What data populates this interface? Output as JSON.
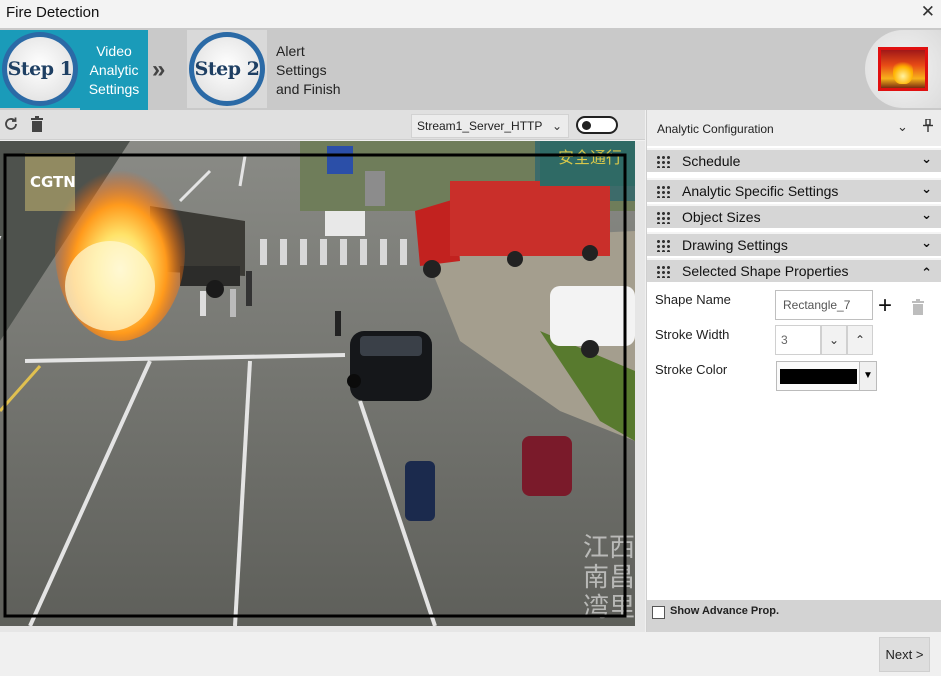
{
  "window": {
    "title": "Fire Detection",
    "close_glyph": "✕"
  },
  "steps": [
    {
      "badge": "Step 1",
      "label": "Video\nAnalytic\nSettings",
      "active": true
    },
    {
      "badge": "Step 2",
      "label": "Alert\nSettings\nand Finish",
      "active": false
    }
  ],
  "steps_separator": "»",
  "colors": {
    "accent": "#1a9bb9",
    "step_ring": "#2b6aa6",
    "panel_header": "#d6d6d6"
  },
  "video_toolbar": {
    "refresh_icon": "refresh-icon",
    "delete_icon": "trash-icon",
    "stream": "Stream1_Server_HTTP",
    "toggle_on": false
  },
  "video": {
    "overlay_left": "CGTN",
    "overlay_right": "江西南昌湾里",
    "sign_text": "安全通行",
    "drawn_shape": {
      "name": "Rectangle_7",
      "stroke_width": 3,
      "stroke_color": "#000000"
    }
  },
  "panel": {
    "title": "Analytic Configuration",
    "sections": [
      {
        "label": "Schedule",
        "expanded": false
      },
      {
        "label": "Analytic Specific Settings",
        "expanded": false
      },
      {
        "label": "Object Sizes",
        "expanded": false
      },
      {
        "label": "Drawing Settings",
        "expanded": false
      },
      {
        "label": "Selected Shape Properties",
        "expanded": true
      }
    ],
    "shape_name_label": "Shape Name",
    "shape_name_value": "Rectangle_7",
    "stroke_width_label": "Stroke Width",
    "stroke_width_value": "3",
    "stroke_color_label": "Stroke Color",
    "stroke_color_value": "#000000",
    "show_advance_label": "Show Advance Prop.",
    "show_advance_checked": false
  },
  "footer": {
    "next_label": "Next >"
  }
}
